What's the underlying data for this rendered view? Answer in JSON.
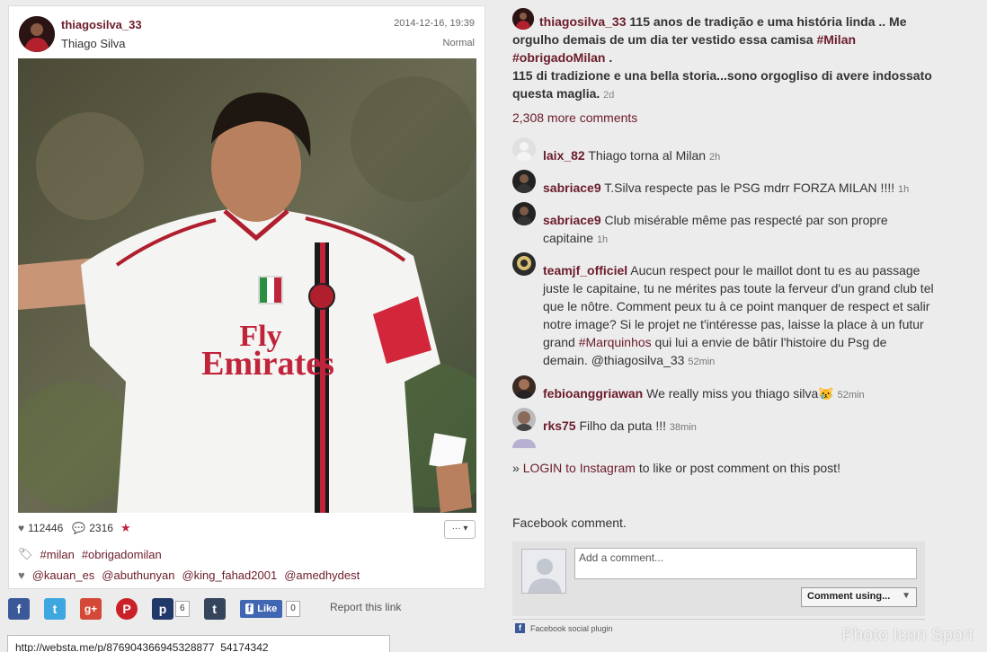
{
  "post": {
    "username": "thiagosilva_33",
    "full_name": "Thiago Silva",
    "date": "2014-12-16, 19:39",
    "filter": "Normal",
    "likes": "112446",
    "comments_count": "2316",
    "more_label": "···  ▾",
    "tags": [
      "#milan",
      "#obrigadomilan"
    ],
    "liked_by": [
      "@kauan_es",
      "@abuthunyan",
      "@king_fahad2001",
      "@amedhydest"
    ],
    "photo_jersey_text_1": "Fly",
    "photo_jersey_text_2": "Emirates"
  },
  "share": {
    "facebook_icon": "f",
    "twitter_icon": "t",
    "google_icon": "g+",
    "pinterest_icon": "P",
    "pocket_icon": "p",
    "pocket_count": "6",
    "tumblr_icon": "t",
    "fb_like_label": "Like",
    "fb_like_count": "0",
    "report_label": "Report this link",
    "url": "http://websta.me/p/876904366945328877_54174342"
  },
  "caption": {
    "username": "thiagosilva_33",
    "text_1": " 115 anos de tradição e uma história linda .. Me orgulho demais de um dia ter vestido essa camisa ",
    "hash_1": "#Milan",
    "hash_2": "#obrigadoMilan",
    "text_2": " .",
    "text_3": "115 di tradizione e una bella storia...sono orgogliso di avere indossato questa maglia.",
    "time": "2d"
  },
  "more_comments": "2,308 more comments",
  "comments": [
    {
      "user": "laix_82",
      "text": "Thiago torna al Milan",
      "time": "2h"
    },
    {
      "user": "sabriace9",
      "text": "T.Silva respecte pas le PSG mdrr FORZA MILAN !!!!",
      "time": "1h"
    },
    {
      "user": "sabriace9",
      "text": "Club misérable même pas respecté par son propre capitaine",
      "time": "1h"
    },
    {
      "user": "teamjf_officiel",
      "text_1": "Aucun respect pour le maillot dont tu es au passage juste le capitaine, tu ne mérites pas toute la ferveur d'un grand club tel que le nôtre. Comment peux tu à ce point manquer de respect et salir notre image? Si le projet ne t'intéresse pas, laisse la place à un futur grand ",
      "hash": "#Marquinhos",
      "text_2": " qui lui a envie de bâtir l'histoire du Psg de demain. ",
      "mention": "@thiagosilva_33",
      "time": "52min"
    },
    {
      "user": "febioanggriawan",
      "text": "We really miss you thiago silva",
      "emoji": "😿",
      "time": "52min"
    },
    {
      "user": "rks75",
      "text": "Filho da puta !!!",
      "time": "38min"
    }
  ],
  "login": {
    "prefix": "» ",
    "link": "LOGIN to Instagram",
    "suffix": " to like or post comment on this post!"
  },
  "facebook": {
    "title": "Facebook comment.",
    "placeholder": "Add a comment...",
    "select_label": "Comment using...",
    "plugin_label": "Facebook social plugin"
  },
  "watermark": "Photo Icon Sport",
  "colors": {
    "accent": "#6b1c2a",
    "background": "#ececec",
    "facebook": "#3b5998"
  }
}
